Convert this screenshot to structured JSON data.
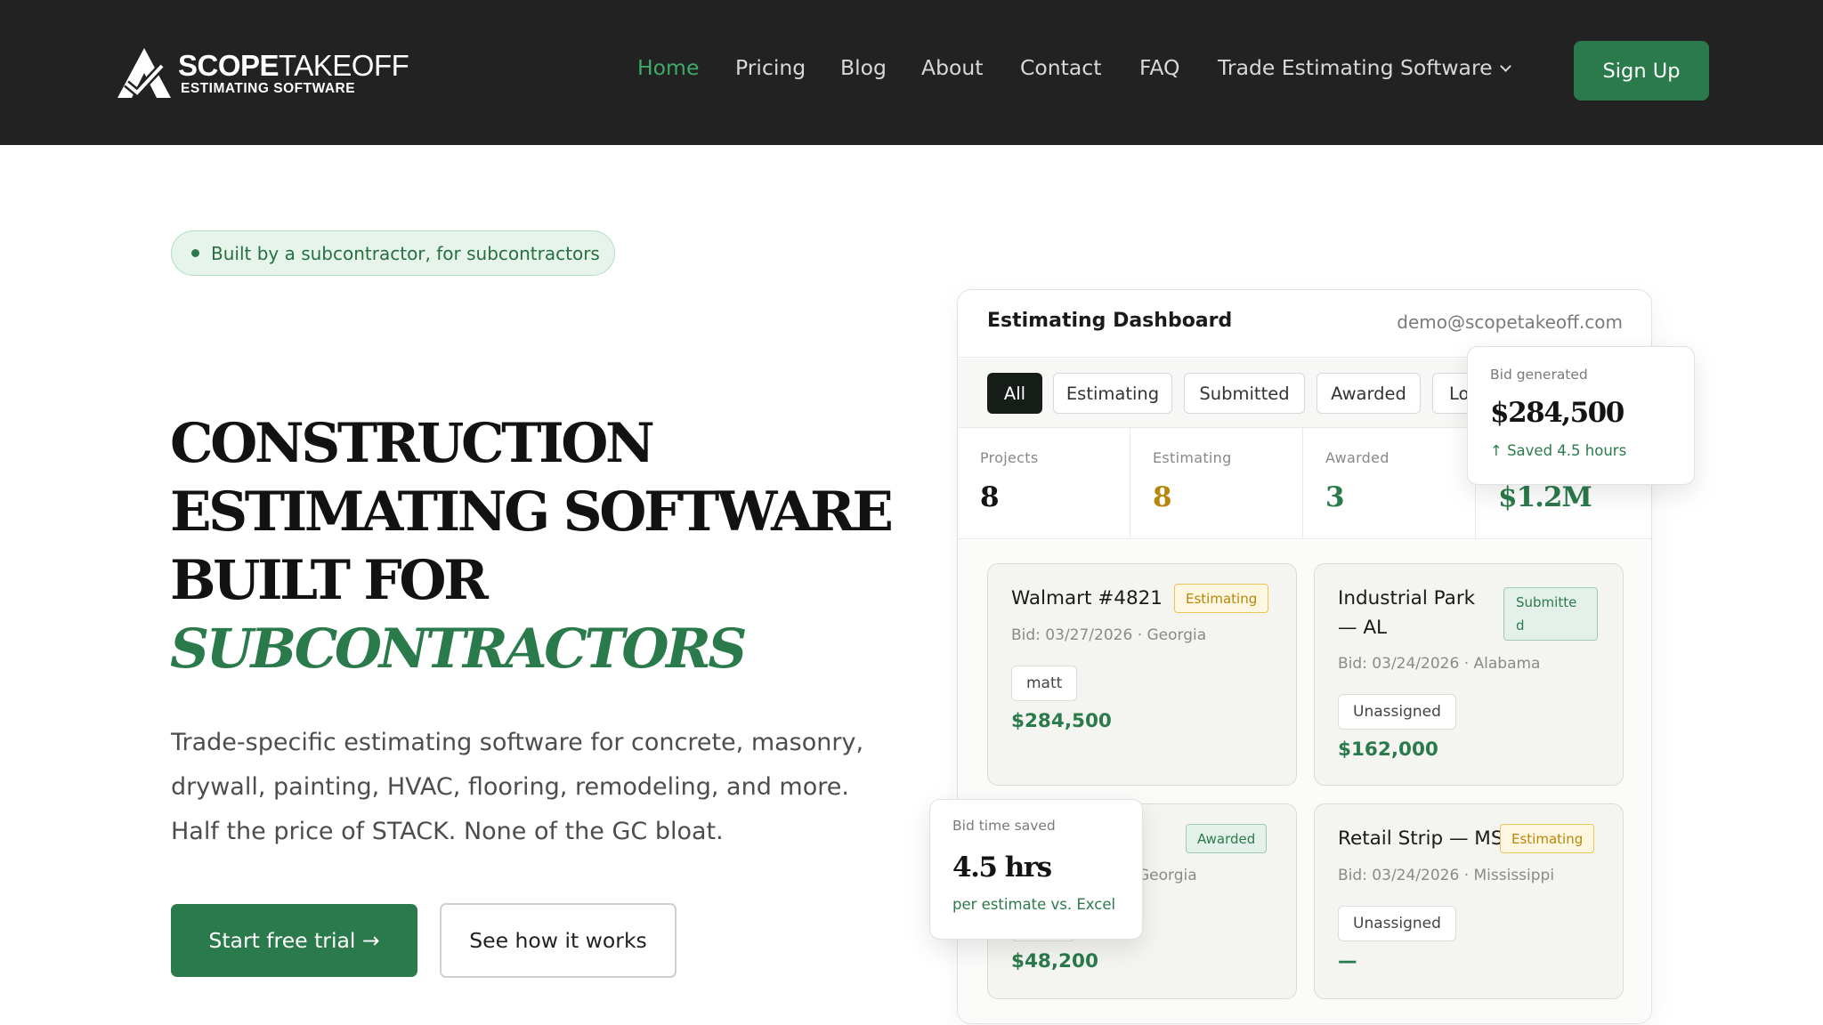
{
  "nav": {
    "logo": {
      "word_bold": "SCOPE",
      "word_light": "TAKEOFF",
      "tagline": "ESTIMATING SOFTWARE"
    },
    "links": [
      {
        "label": "Home",
        "active": true
      },
      {
        "label": "Pricing"
      },
      {
        "label": "Blog"
      },
      {
        "label": "About"
      },
      {
        "label": "Contact"
      },
      {
        "label": "FAQ"
      },
      {
        "label": "Trade Estimating Software",
        "has_dropdown": true
      }
    ],
    "signup_label": "Sign Up"
  },
  "hero": {
    "pill_text": "Built by a subcontractor, for subcontractors",
    "headline_lines": [
      "CONSTRUCTION",
      "ESTIMATING SOFTWARE",
      "BUILT FOR"
    ],
    "headline_accent": "SUBCONTRACTORS",
    "subcopy_lines": [
      "Trade-specific estimating software for concrete, masonry,",
      "drywall, painting, HVAC, flooring, remodeling, and more.",
      "Half the price of STACK. None of the GC bloat."
    ],
    "primary_cta": "Start free trial →",
    "secondary_cta": "See how it works"
  },
  "dashboard": {
    "title": "Estimating Dashboard",
    "email": "demo@scopetakeoff.com",
    "tabs": [
      "All",
      "Estimating",
      "Submitted",
      "Awarded",
      "Lo"
    ],
    "active_tab": "All",
    "stats": [
      {
        "label": "Projects",
        "value": "8"
      },
      {
        "label": "Estimating",
        "value": "8"
      },
      {
        "label": "Awarded",
        "value": "3"
      },
      {
        "label": "",
        "value": "$1.2M"
      }
    ],
    "projects": [
      {
        "name": "Walmart #4821",
        "status": "Estimating",
        "meta": "Bid: 03/27/2026 · Georgia",
        "assignee": "matt",
        "amount": "$284,500"
      },
      {
        "name": "Industrial Park — AL",
        "status": "Submitte d",
        "meta": "Bid: 03/24/2026 · Alabama",
        "assignee": "Unassigned",
        "amount": "$162,000"
      },
      {
        "name": "",
        "status": "Awarded",
        "meta": "Georgia",
        "assignee": "",
        "amount": "$48,200"
      },
      {
        "name": "Retail Strip — MS",
        "status": "Estimating",
        "meta": "Bid: 03/24/2026 · Mississippi",
        "assignee": "Unassigned",
        "amount": "—"
      }
    ]
  },
  "tooltips": {
    "bid_generated": {
      "label": "Bid generated",
      "value": "$284,500",
      "note": "Saved 4.5 hours"
    },
    "bid_time": {
      "label": "Bid time saved",
      "value": "4.5 hrs",
      "note": "per estimate vs. Excel"
    }
  },
  "colors": {
    "nav_bg": "#222222",
    "brand_green": "#2b7a4b",
    "active_link": "#3faa67",
    "estimating_amber": "#b8860b"
  }
}
